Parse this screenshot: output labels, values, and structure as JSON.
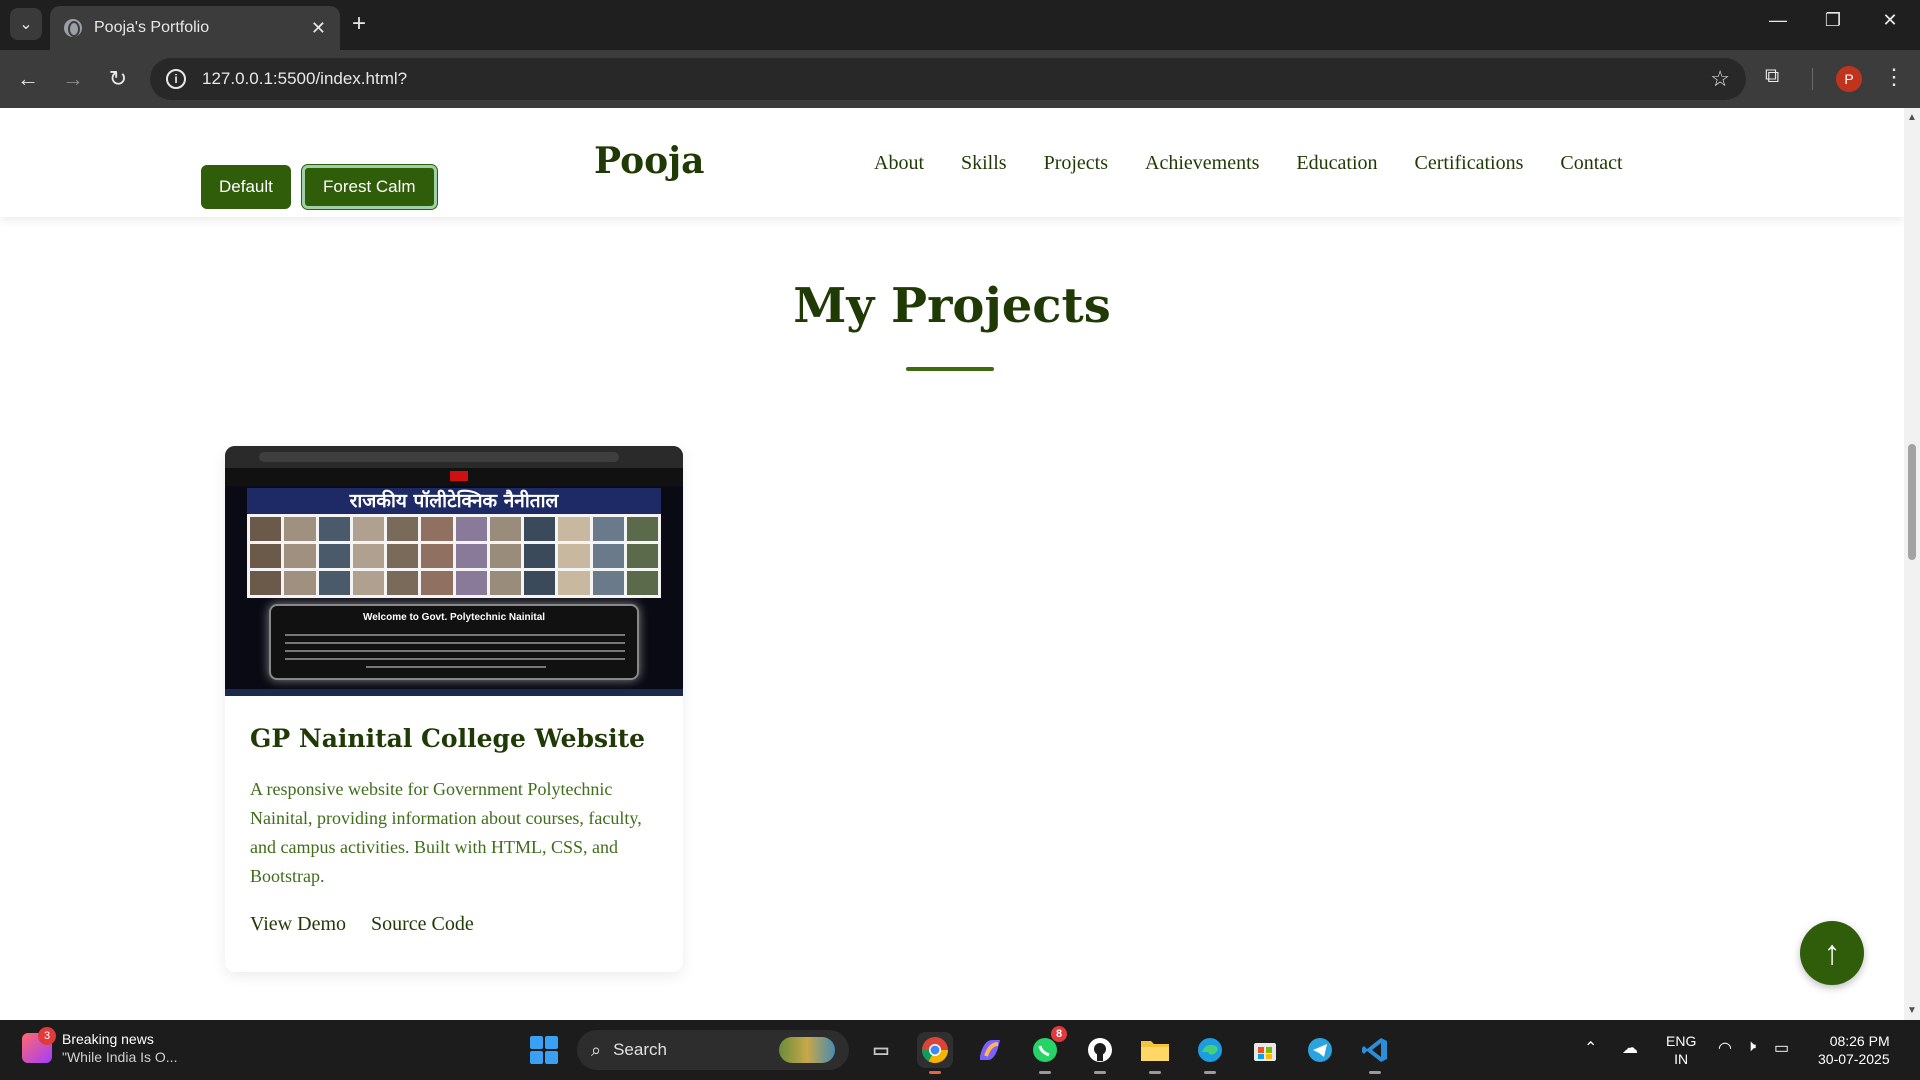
{
  "browser": {
    "tab_title": "Pooja's Portfolio",
    "url": "127.0.0.1:5500/index.html?",
    "profile_initial": "P"
  },
  "header": {
    "theme_buttons": [
      "Default",
      "Forest Calm"
    ],
    "brand": "Pooja",
    "nav": [
      "About",
      "Skills",
      "Projects",
      "Achievements",
      "Education",
      "Certifications",
      "Contact"
    ]
  },
  "projects": {
    "title": "My Projects",
    "card": {
      "screenshot_banner": "राजकीय पॉलीटेक्निक नैनीताल",
      "screenshot_welcome": "Welcome to Govt. Polytechnic Nainital",
      "title": "GP Nainital College Website",
      "description": "A responsive website for Government Polytechnic Nainital, providing information about courses, faculty, and campus activities. Built with HTML, CSS, and Bootstrap.",
      "links": [
        "View Demo",
        "Source Code"
      ]
    }
  },
  "taskbar": {
    "news_badge": "3",
    "news_title": "Breaking news",
    "news_sub": "\"While India Is O...",
    "search_placeholder": "Search",
    "whatsapp_badge": "8",
    "lang_1": "ENG",
    "lang_2": "IN",
    "time": "08:26 PM",
    "date": "30-07-2025"
  },
  "colors": {
    "primary": "#2f5d0a",
    "heading": "#1f3a05",
    "text": "#3f6d1a"
  }
}
